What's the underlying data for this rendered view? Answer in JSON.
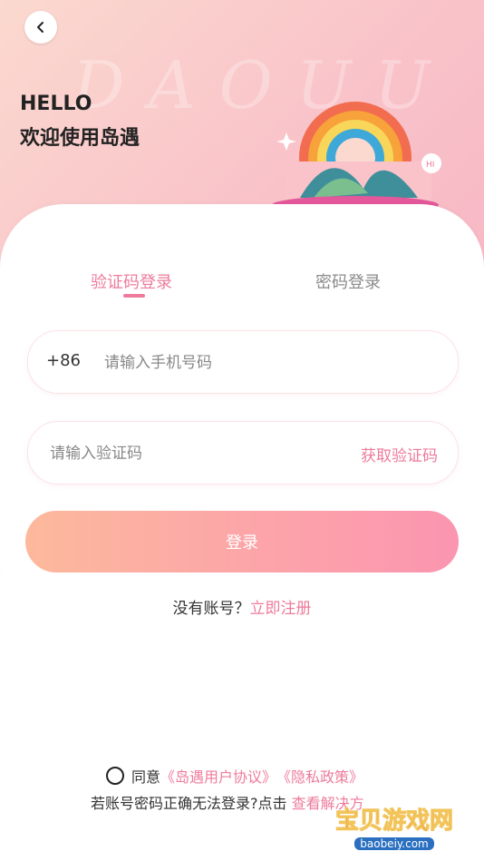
{
  "header": {
    "hello": "HELLO",
    "welcome": "欢迎使用岛遇",
    "watermark_letters": "DAOUU"
  },
  "tabs": [
    {
      "label": "验证码登录",
      "active": true
    },
    {
      "label": "密码登录",
      "active": false
    }
  ],
  "phone": {
    "prefix": "+86",
    "placeholder": "请输入手机号码",
    "value": ""
  },
  "code": {
    "placeholder": "请输入验证码",
    "value": "",
    "get_code_label": "获取验证码"
  },
  "login_label": "登录",
  "register": {
    "text": "没有账号？",
    "link": "立即注册"
  },
  "agreement": {
    "text": "同意",
    "user_agreement": "《岛遇用户协议》",
    "privacy_policy": "《隐私政策》"
  },
  "help": {
    "text": "若账号密码正确无法登录?点击 ",
    "link": "查看解决方"
  },
  "watermark": {
    "title": "宝贝游戏网",
    "url": "baobeiy.com"
  },
  "colors": {
    "accent": "#ee7b9b",
    "button_start": "#fdb99c",
    "button_end": "#fb95b0"
  }
}
